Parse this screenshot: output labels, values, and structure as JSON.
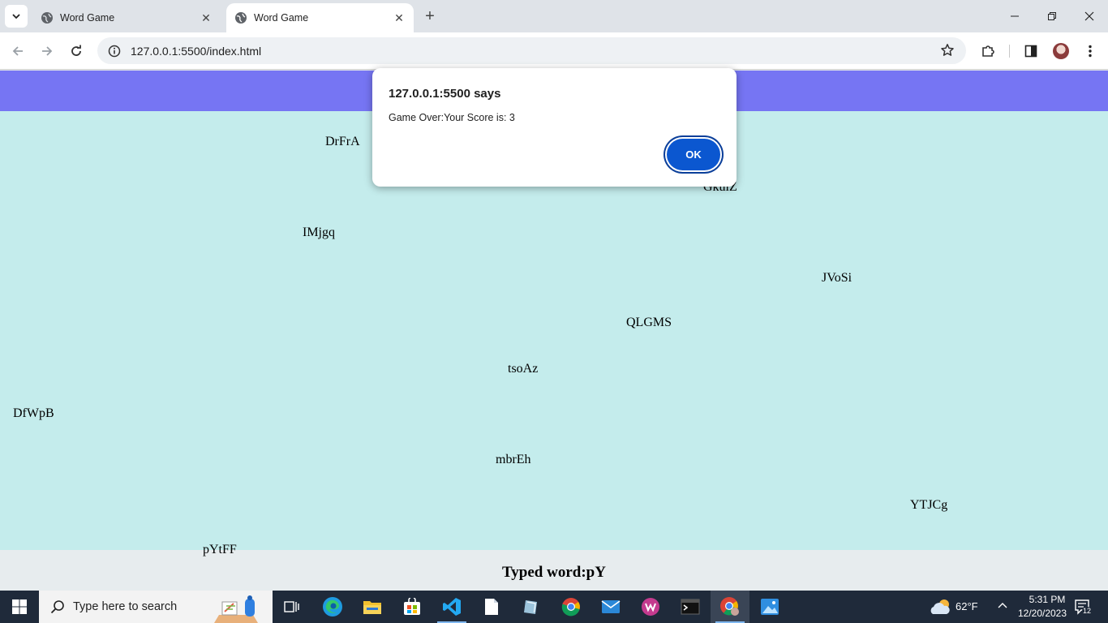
{
  "browser": {
    "tabs": [
      {
        "title": "Word Game",
        "active": false
      },
      {
        "title": "Word Game",
        "active": true
      }
    ],
    "url": "127.0.0.1:5500/index.html"
  },
  "game": {
    "words": [
      "DrFrA",
      "GkulZ",
      "IMjgq",
      "JVoSi",
      "QLGMS",
      "tsoAz",
      "DfWpB",
      "mbrEh",
      "YTJCg",
      "pYtFF"
    ],
    "typed_label": "Typed word:pY"
  },
  "dialog": {
    "title": "127.0.0.1:5500 says",
    "message": "Game Over:Your Score is: 3",
    "ok_label": "OK"
  },
  "taskbar": {
    "search_placeholder": "Type here to search",
    "temperature": "62°F",
    "time": "5:31 PM",
    "date": "12/20/2023",
    "notification_count": "12"
  },
  "colors": {
    "header": "#7675f3",
    "play_area": "#c4ecec",
    "accent": "#0b57d0"
  }
}
